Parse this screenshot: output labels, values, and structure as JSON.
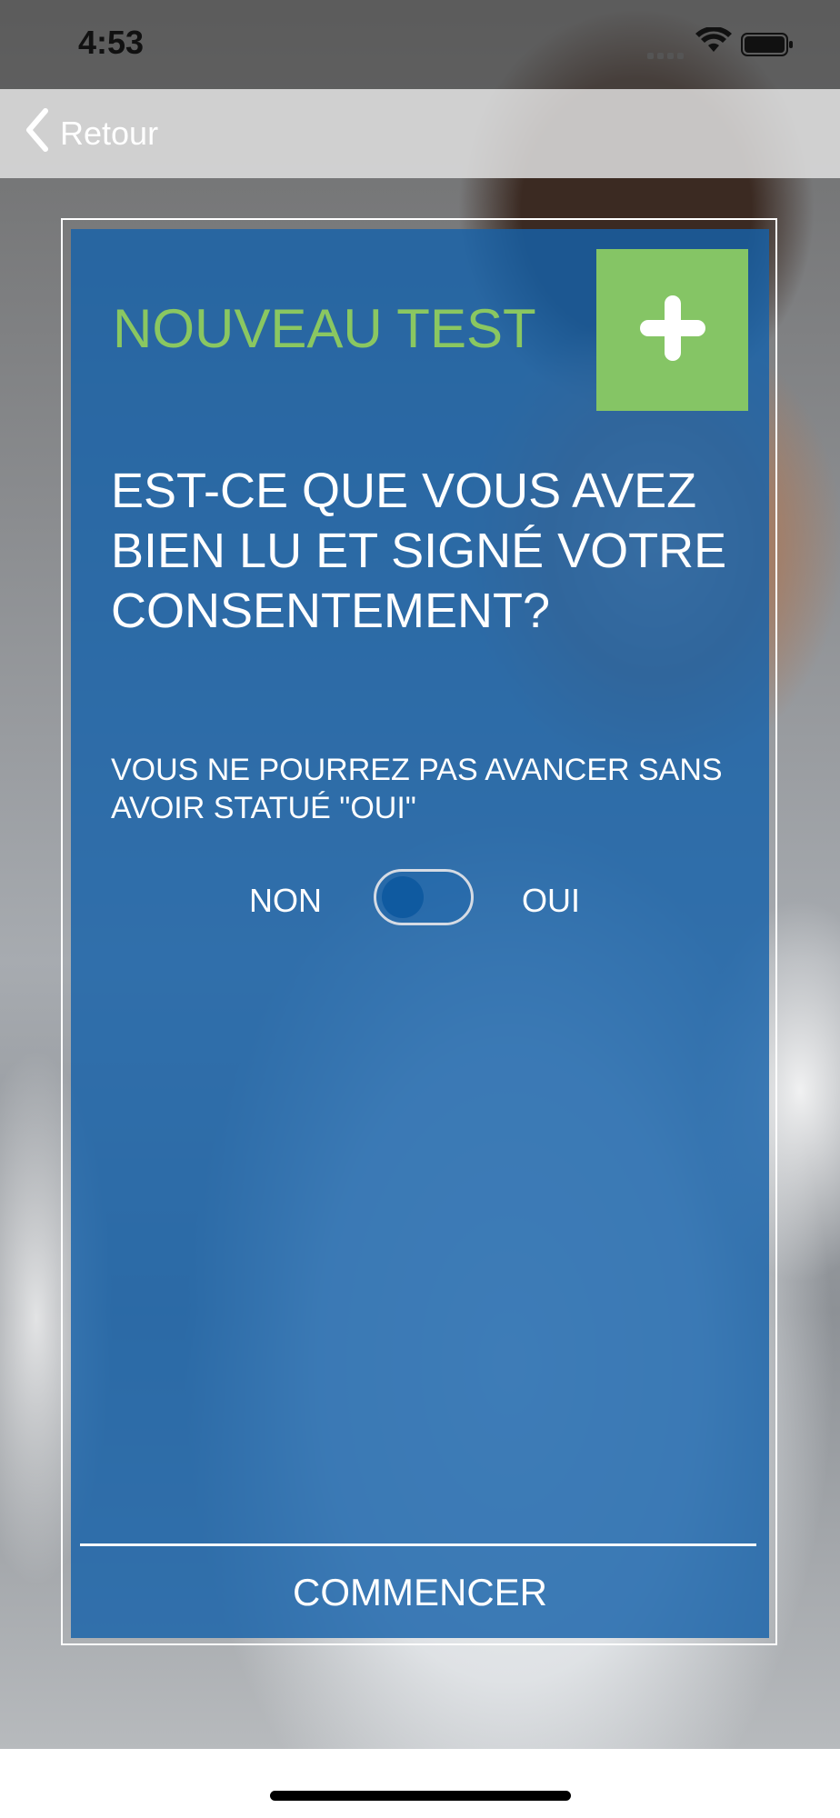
{
  "status_bar": {
    "time": "4:53",
    "signal_icon": "cellular-signal-icon",
    "wifi_icon": "wifi-icon",
    "battery_icon": "battery-icon"
  },
  "nav": {
    "back_label": "Retour",
    "back_icon": "chevron-left-icon"
  },
  "card": {
    "title": "NOUVEAU TEST",
    "title_color": "#8ac761",
    "accent_green": "#85c565",
    "card_blue": "#1661aa",
    "plus_icon": "plus-icon",
    "question": "EST-CE QUE VOUS AVEZ BIEN LU ET SIGNÉ VOTRE CONSENTEMENT?",
    "note": "VOUS NE POURREZ PAS AVANCER SANS AVOIR STATUÉ \"OUI\"",
    "toggle": {
      "off_label": "NON",
      "on_label": "OUI",
      "state": "NON"
    },
    "start_button": "COMMENCER"
  }
}
